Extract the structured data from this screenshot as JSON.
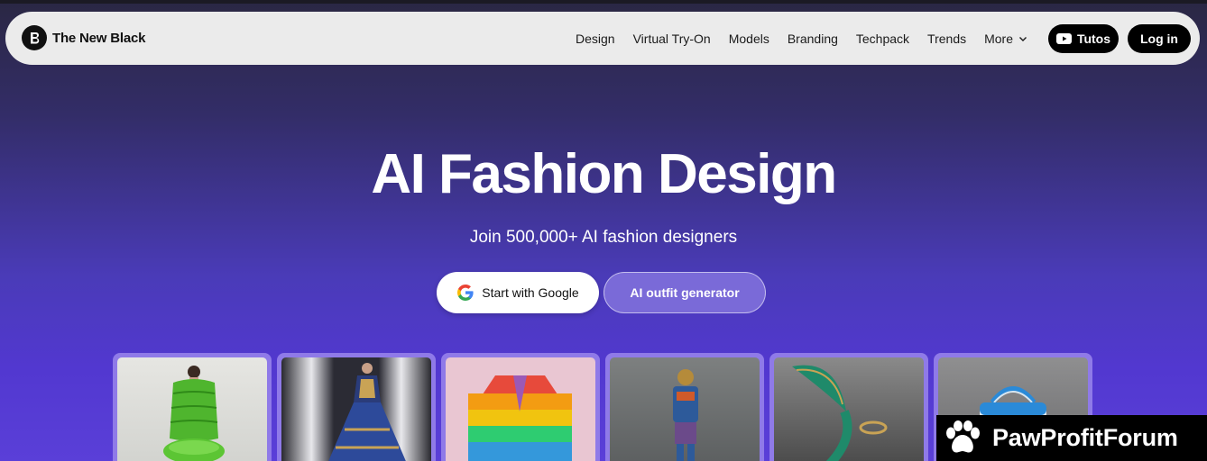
{
  "nav": {
    "brand": "The New Black",
    "items": [
      {
        "label": "Design"
      },
      {
        "label": "Virtual Try-On"
      },
      {
        "label": "Models"
      },
      {
        "label": "Branding"
      },
      {
        "label": "Techpack"
      },
      {
        "label": "Trends"
      },
      {
        "label": "More"
      }
    ],
    "tutos_label": "Tutos",
    "login_label": "Log in"
  },
  "hero": {
    "title": "AI Fashion Design",
    "subtitle": "Join 500,000+ AI fashion designers",
    "google_button": "Start with Google",
    "outfit_button": "AI outfit generator"
  },
  "gallery": {
    "items": [
      {
        "name": "green-puffer-jacket-image"
      },
      {
        "name": "runway-gown-image"
      },
      {
        "name": "rainbow-coat-image"
      },
      {
        "name": "armored-figure-image"
      },
      {
        "name": "green-heel-shoe-image"
      },
      {
        "name": "blue-handbag-image"
      }
    ]
  },
  "badge": {
    "label": "PawProfitForum"
  },
  "colors": {
    "accent": "#5238d0",
    "nav_bg": "#ebebeb",
    "button_dark": "#000000"
  }
}
